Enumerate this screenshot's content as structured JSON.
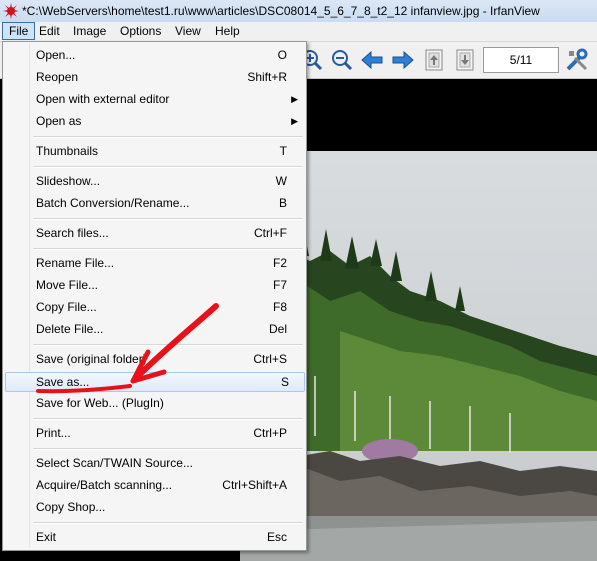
{
  "window": {
    "title": "*C:\\WebServers\\home\\test1.ru\\www\\articles\\DSC08014_5_6_7_8_t2_12 infanview.jpg - IrfanView"
  },
  "menubar": [
    "File",
    "Edit",
    "Image",
    "Options",
    "View",
    "Help"
  ],
  "toolbar": {
    "icons": [
      "zoom-in-icon",
      "zoom-out-icon",
      "previous-icon",
      "next-icon",
      "page-up-icon",
      "page-down-icon",
      "tools-icon"
    ],
    "page_indicator": "5/11"
  },
  "file_menu": {
    "items": [
      {
        "label": "Open...",
        "shortcut": "O"
      },
      {
        "label": "Reopen",
        "shortcut": "Shift+R"
      },
      {
        "label": "Open with external editor",
        "shortcut": ""
      },
      {
        "label": "Open as",
        "shortcut": ""
      },
      {
        "label": "Thumbnails",
        "shortcut": "T"
      },
      {
        "label": "Slideshow...",
        "shortcut": "W"
      },
      {
        "label": "Batch Conversion/Rename...",
        "shortcut": "B"
      },
      {
        "label": "Search files...",
        "shortcut": "Ctrl+F"
      },
      {
        "label": "Rename File...",
        "shortcut": "F2"
      },
      {
        "label": "Move File...",
        "shortcut": "F7"
      },
      {
        "label": "Copy File...",
        "shortcut": "F8"
      },
      {
        "label": "Delete File...",
        "shortcut": "Del"
      },
      {
        "label": "Save (original folder)",
        "shortcut": "Ctrl+S"
      },
      {
        "label": "Save as...",
        "shortcut": "S"
      },
      {
        "label": "Save for Web... (PlugIn)",
        "shortcut": ""
      },
      {
        "label": "Print...",
        "shortcut": "Ctrl+P"
      },
      {
        "label": "Select Scan/TWAIN Source...",
        "shortcut": ""
      },
      {
        "label": "Acquire/Batch scanning...",
        "shortcut": "Ctrl+Shift+A"
      },
      {
        "label": "Copy Shop...",
        "shortcut": ""
      },
      {
        "label": "Exit",
        "shortcut": "Esc"
      }
    ],
    "highlighted": "Save as..."
  },
  "colors": {
    "highlight_border": "#a8c8ec",
    "annotation_red": "#e8111a"
  }
}
